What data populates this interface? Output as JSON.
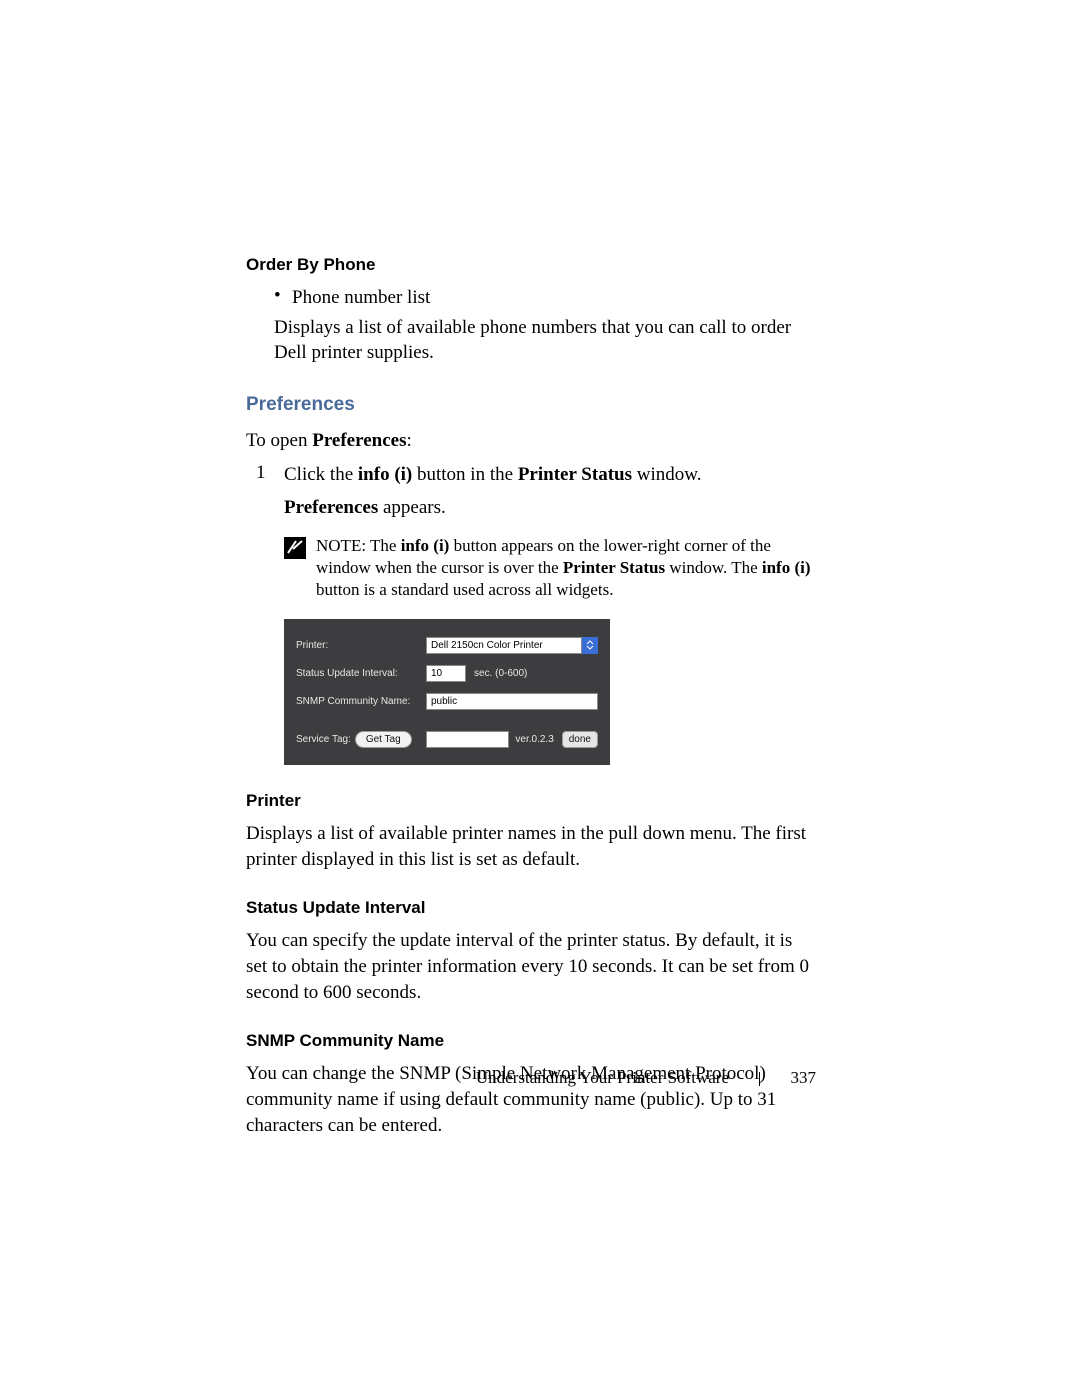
{
  "orderSection": {
    "heading": "Order By Phone",
    "bullet": "Phone number list",
    "desc": "Displays a list of available phone numbers that you can call to order Dell printer supplies."
  },
  "prefsSection": {
    "heading": "Preferences",
    "toOpenPre": "To open ",
    "toOpenBold": "Preferences",
    "toOpenPost": ":",
    "step1Num": "1",
    "step1a": "Click the ",
    "step1b": "info (i)",
    "step1c": " button in the ",
    "step1d": "Printer Status",
    "step1e": " window.",
    "appearsBold": "Preferences",
    "appearsRest": " appears.",
    "noteLead": "NOTE: ",
    "note_a": "The ",
    "note_b": "info (i)",
    "note_c": " button appears on the lower-right corner of the window when the cursor is over the ",
    "note_d": "Printer Status",
    "note_e": " window. The ",
    "note_f": "info (i)",
    "note_g": " button is a standard used across all widgets."
  },
  "panel": {
    "printerLabel": "Printer:",
    "printerValue": "Dell 2150cn Color Printer",
    "intervalLabel": "Status Update Interval:",
    "intervalValue": "10",
    "intervalUnit": "sec. (0-600)",
    "snmpLabel": "SNMP Community Name:",
    "snmpValue": "public",
    "serviceTagLabel": "Service Tag:",
    "getTag": "Get Tag",
    "version": "ver.0.2.3",
    "done": "done"
  },
  "printerSection": {
    "heading": "Printer",
    "body": "Displays a list of available printer names in the pull down menu. The first printer displayed in this list is set as default."
  },
  "intervalSection": {
    "heading": "Status Update Interval",
    "body": "You can specify the update interval of the printer status. By default, it is set to obtain the printer information every 10 seconds. It can be set from 0 second to 600 seconds."
  },
  "snmpSection": {
    "heading": "SNMP Community Name",
    "body": "You can change the SNMP (Simple Network Management Protocol) community name if using default community name (public). Up to 31 characters can be entered."
  },
  "footer": {
    "chapter": "Understanding Your Printer Software",
    "page": "337"
  }
}
